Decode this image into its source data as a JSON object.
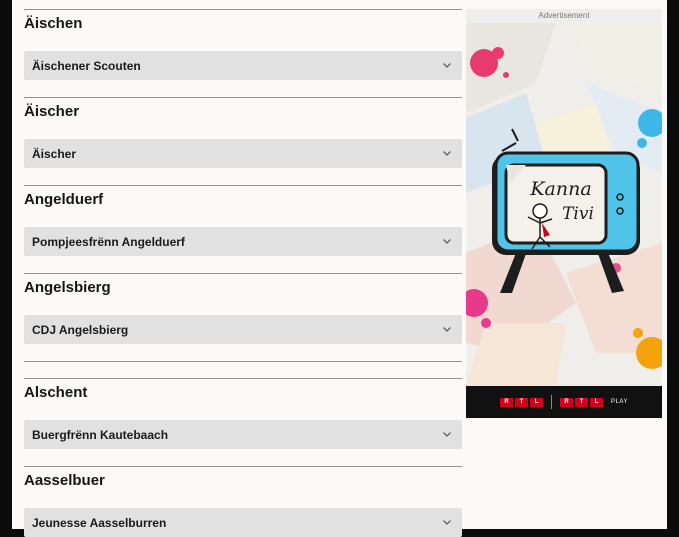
{
  "sections": [
    {
      "title": "Äischen",
      "item": "Äischener Scouten"
    },
    {
      "title": "Äischer",
      "item": "Äischer"
    },
    {
      "title": "Angelduerf",
      "item": "Pompjeesfrënn Angelduerf"
    },
    {
      "title": "Angelsbierg",
      "item": "CDJ Angelsbierg"
    },
    {
      "title": "Alschent",
      "item": "Buergfrënn Kautebaach"
    },
    {
      "title": "Aasselbuer",
      "item": "Jeunesse Aasselburren"
    }
  ],
  "ad": {
    "label": "Advertisement",
    "logo_line1": "Kanna",
    "logo_line2": "Tivi",
    "brand_letters": [
      "R",
      "T",
      "L"
    ],
    "play_label": "PLAY"
  },
  "colors": {
    "page_bg": "#fbfaf8",
    "accordion_bg": "#e1e1e1",
    "tv_blue": "#4fc3e8",
    "rtl_red": "#d0021b"
  }
}
